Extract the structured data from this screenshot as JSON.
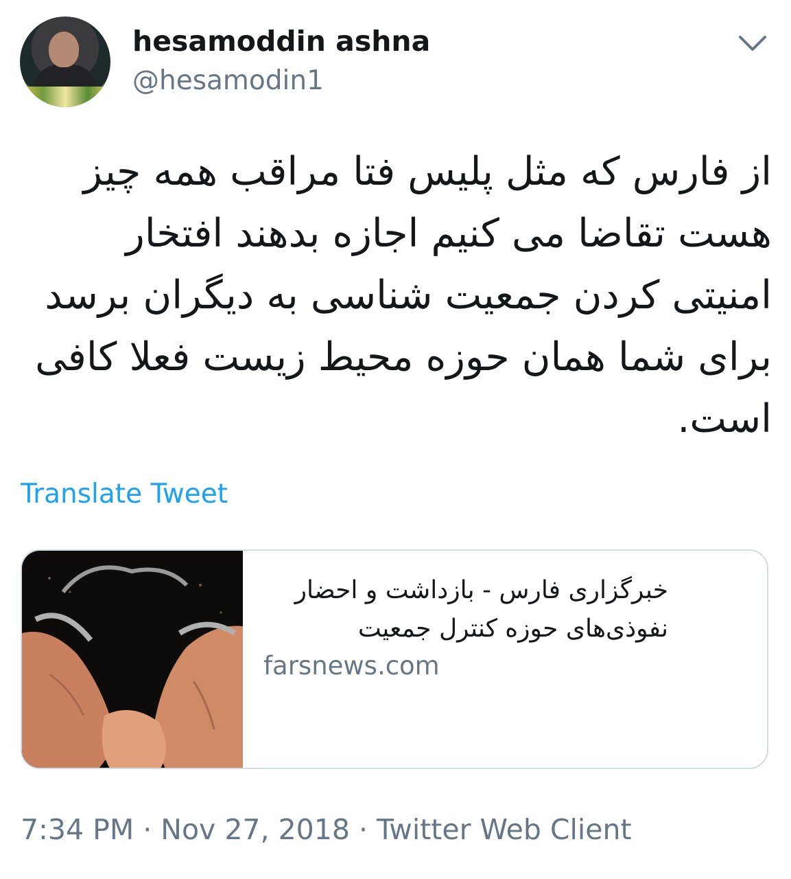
{
  "tweet": {
    "author": {
      "display_name": "hesamoddin ashna",
      "handle": "@hesamodin1"
    },
    "lines": [
      "از فارس که مثل پلیس فتا مراقب همه چیز",
      "هست تقاضا می کنیم اجازه بدهند افتخار",
      "امنیتی کردن جمعیت شناسی به دیگران برسد",
      "برای شما همان حوزه محیط زیست فعلا کافی",
      "است."
    ],
    "translate_label": "Translate Tweet",
    "card": {
      "title_lines": [
        "خبرگزاری فارس - بازداشت و احضار",
        "نفوذی‌های حوزه کنترل جمعیت"
      ],
      "domain": "farsnews.com"
    },
    "meta": "7:34 PM · Nov 27, 2018 · Twitter Web Client"
  },
  "icons": {
    "menu": "chevron-down-icon",
    "avatar": "avatar"
  },
  "colors": {
    "link": "#1da1f2",
    "secondary": "#657786",
    "text": "#14171a",
    "card_border": "#d0dce3"
  }
}
